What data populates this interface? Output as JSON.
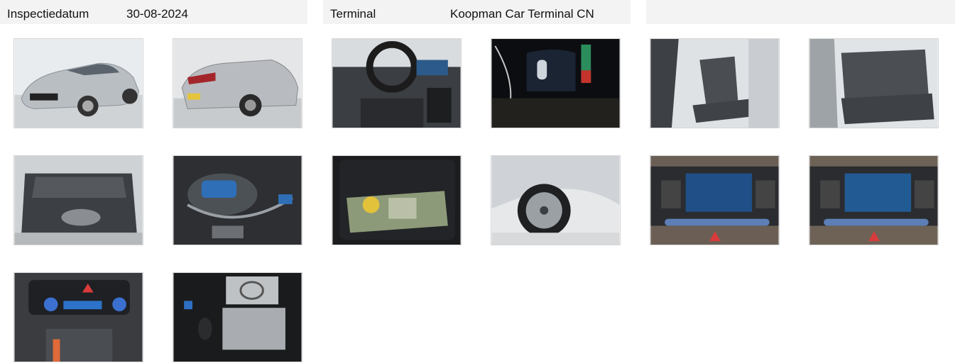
{
  "header": {
    "inspection_date_label": "Inspectiedatum",
    "inspection_date_value": "30-08-2024",
    "terminal_label": "Terminal",
    "terminal_value": "Koopman Car Terminal CN"
  },
  "photos": [
    {
      "subject": "front-three-quarter-exterior"
    },
    {
      "subject": "rear-three-quarter-exterior"
    },
    {
      "subject": "dashboard-steering-wheel"
    },
    {
      "subject": "instrument-cluster"
    },
    {
      "subject": "front-seat-door-open"
    },
    {
      "subject": "rear-seats"
    },
    {
      "subject": "trunk-open"
    },
    {
      "subject": "charging-cable"
    },
    {
      "subject": "tool-bag"
    },
    {
      "subject": "wheel-rim"
    },
    {
      "subject": "infotainment-screen"
    },
    {
      "subject": "infotainment-screen-alt"
    },
    {
      "subject": "climate-control-panel"
    },
    {
      "subject": "keys-and-manual"
    }
  ]
}
